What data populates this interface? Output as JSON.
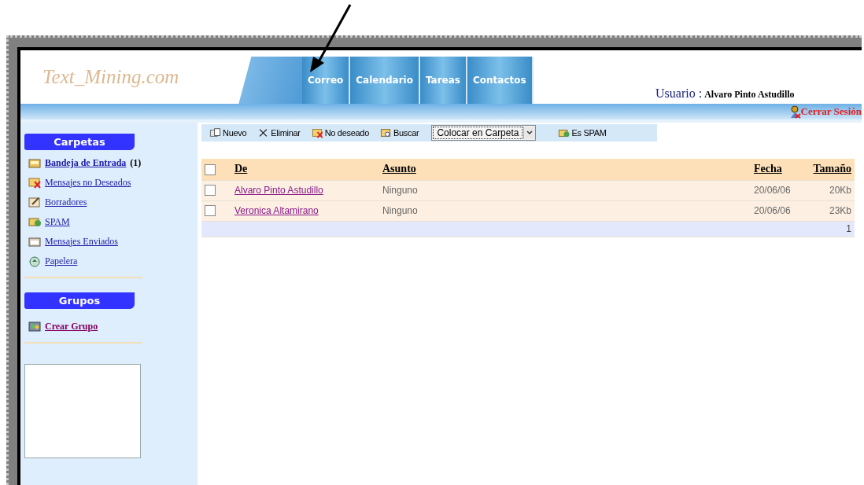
{
  "logo": "Text_Mining.com",
  "tabs": [
    {
      "label": "Correo"
    },
    {
      "label": "Calendario"
    },
    {
      "label": "Tareas"
    },
    {
      "label": "Contactos"
    }
  ],
  "user": {
    "label": "Usuario :",
    "name": "Alvaro Pinto Astudillo"
  },
  "logout": "Cerrar Sesión",
  "sidebar": {
    "folders_title": "Carpetas",
    "folders": [
      {
        "kind": "inbox",
        "label": "Bandeja de Entrada",
        "count": "(1)"
      },
      {
        "kind": "junk",
        "label": "Mensajes no Deseados"
      },
      {
        "kind": "draft",
        "label": "Borradores"
      },
      {
        "kind": "spam",
        "label": "SPAM"
      },
      {
        "kind": "sent",
        "label": "Mensajes Enviados"
      },
      {
        "kind": "trash",
        "label": "Papelera"
      }
    ],
    "groups_title": "Grupos",
    "groups": [
      {
        "kind": "group",
        "label": "Crear Grupo"
      }
    ]
  },
  "toolbar": [
    {
      "kind": "new",
      "label": "Nuevo"
    },
    {
      "kind": "delete",
      "label": "Eliminar"
    },
    {
      "kind": "junk",
      "label": "No deseado"
    },
    {
      "kind": "search",
      "label": "Buscar"
    },
    {
      "kind": "select",
      "label": "Colocar en Carpeta"
    },
    {
      "kind": "spam",
      "label": "Es SPAM"
    }
  ],
  "table": {
    "columns": [
      "De",
      "Asunto",
      "Fecha",
      "Tamaño"
    ],
    "header_checked": false,
    "rows": [
      {
        "checked": false,
        "from": "Alvaro Pinto Astudillo",
        "subject": "Ninguno",
        "date": "20/06/06",
        "size": "20Kb"
      },
      {
        "checked": false,
        "from": "Veronica Altamirano",
        "subject": "Ninguno",
        "date": "20/06/06",
        "size": "23Kb"
      }
    ],
    "page": "1"
  }
}
